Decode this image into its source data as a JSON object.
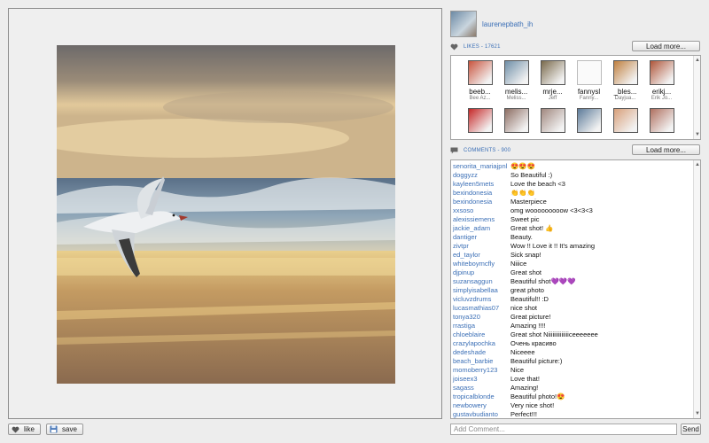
{
  "post": {
    "username": "laurenepbath_ih",
    "likes_label": "LIKES - 17621",
    "comments_label": "COMMENTS - 900",
    "load_more_label": "Load more..."
  },
  "actions": {
    "like_label": "like",
    "save_label": "save"
  },
  "likers": [
    {
      "name": "beeb...",
      "sub": "Bee Az...",
      "color": "#c9543e"
    },
    {
      "name": "melis...",
      "sub": "Meliss...",
      "color": "#6f8fa8"
    },
    {
      "name": "mrje...",
      "sub": "Jeff",
      "color": "#7a6a4c"
    },
    {
      "name": "fannysl",
      "sub": "Fanny...",
      "color": "#ffffff"
    },
    {
      "name": "_bles...",
      "sub": "Dayjua...",
      "color": "#c08040"
    },
    {
      "name": "erikj...",
      "sub": "Erik Jo...",
      "color": "#b0563a"
    },
    {
      "name": "",
      "sub": "",
      "color": "#c62828"
    },
    {
      "name": "",
      "sub": "",
      "color": "#8d6e63"
    },
    {
      "name": "",
      "sub": "",
      "color": "#a1887f"
    },
    {
      "name": "",
      "sub": "",
      "color": "#5d7b9a"
    },
    {
      "name": "",
      "sub": "",
      "color": "#d8a07a"
    },
    {
      "name": "",
      "sub": "",
      "color": "#b07060"
    }
  ],
  "comments": [
    {
      "user": "senorita_mariajpnl",
      "text": "😍😍😍"
    },
    {
      "user": "doggyzz",
      "text": "So Beautiful :)"
    },
    {
      "user": "kayleen5mets",
      "text": "Love the beach <3"
    },
    {
      "user": "bexindonesia",
      "text": "👏👏👏"
    },
    {
      "user": "bexindonesia",
      "text": "Masterpiece"
    },
    {
      "user": "xxsoso",
      "text": "omg wooooooooow <3<3<3"
    },
    {
      "user": "alexissiemens",
      "text": "Sweet pic"
    },
    {
      "user": "jackie_adam",
      "text": "Great shot! 👍"
    },
    {
      "user": "dantiger",
      "text": "Beauty."
    },
    {
      "user": "zivtpr",
      "text": "Wow !! Love it !! It's amazing"
    },
    {
      "user": "ed_taylor",
      "text": "Sick snap!"
    },
    {
      "user": "whiteboymcfly",
      "text": "Niiice"
    },
    {
      "user": "djpinup",
      "text": "Great shot"
    },
    {
      "user": "suzansaggun",
      "text": "Beautiful shot💜💜💜"
    },
    {
      "user": "simplyisabellaa",
      "text": "great photo"
    },
    {
      "user": "vicluvzdrums",
      "text": "Beautiful!! :D"
    },
    {
      "user": "lucasmathias07",
      "text": "nice shot"
    },
    {
      "user": "tonya320",
      "text": "Great picture!"
    },
    {
      "user": "rrastiga",
      "text": "Amazing !!!!"
    },
    {
      "user": "chloeblaire",
      "text": "Great shot Niiiiiiiiiiiiiiceeeeeee"
    },
    {
      "user": "crazylapochka",
      "text": "Очень красиво"
    },
    {
      "user": "dedeshade",
      "text": "Niceeee"
    },
    {
      "user": "beach_barbie",
      "text": "Beautiful picture:)"
    },
    {
      "user": "momoberry123",
      "text": "Nice"
    },
    {
      "user": "joiseex3",
      "text": "Love that!"
    },
    {
      "user": "sagass",
      "text": "Amazing!"
    },
    {
      "user": "tropicalblonde",
      "text": "Beautiful photo!😍"
    },
    {
      "user": "newbowery",
      "text": "Very nice shot!"
    },
    {
      "user": "gustavbudianto",
      "text": "Perfect!!!"
    }
  ],
  "compose": {
    "placeholder": "Add Comment...",
    "send_label": "Send"
  },
  "icons": {
    "like": "heart-icon",
    "save": "save-icon",
    "likes_section": "heart-icon",
    "comments_section": "speech-bubble-icon"
  }
}
